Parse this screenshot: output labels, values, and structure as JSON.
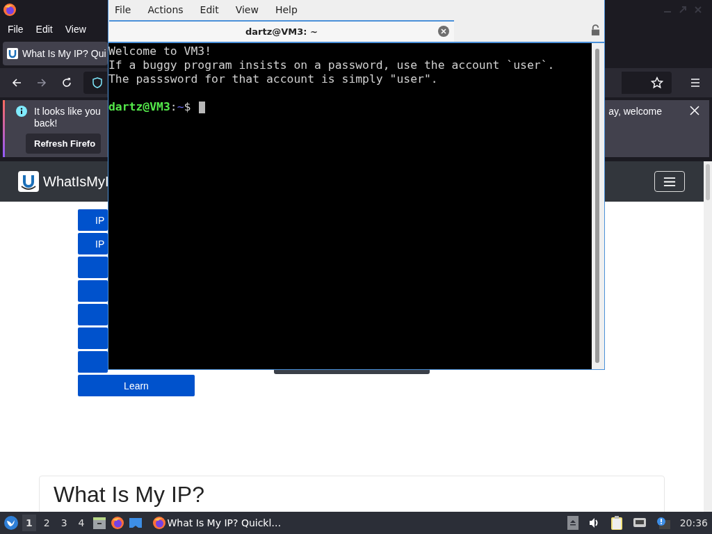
{
  "browser": {
    "menu": [
      "File",
      "Edit",
      "View"
    ],
    "tab": {
      "title": "What Is My IP? Qui"
    },
    "notification": {
      "text_start": "It looks like you",
      "text_end": "ay, welcome",
      "text_second_line": "back!",
      "button": "Refresh Firefo"
    },
    "site": {
      "brand": "WhatIsMyI",
      "nav_buttons": [
        {
          "kind": "labeled",
          "label": "IP"
        },
        {
          "kind": "labeled",
          "label": "IP"
        },
        {
          "kind": "covered"
        },
        {
          "kind": "covered"
        },
        {
          "kind": "covered"
        },
        {
          "kind": "covered"
        },
        {
          "kind": "covered"
        },
        {
          "kind": "labeled",
          "label": "Learn"
        }
      ],
      "card_heading": "What Is My IP?"
    }
  },
  "terminal": {
    "menu": [
      "File",
      "Actions",
      "Edit",
      "View",
      "Help"
    ],
    "tab": {
      "title": "dartz@VM3: ~"
    },
    "lines": [
      {
        "kind": "output",
        "text": "Welcome to VM3!"
      },
      {
        "kind": "output",
        "text": "If a buggy program insists on a password, use the account `user`."
      },
      {
        "kind": "output",
        "text": "The passsword for that account is simply \"user\"."
      },
      {
        "kind": "blank"
      },
      {
        "kind": "prompt",
        "user_host": "dartz@VM3",
        "separator": ":",
        "path": "~",
        "symbol": "$"
      }
    ]
  },
  "taskbar": {
    "workspaces": [
      {
        "label": "1",
        "selected": true
      },
      {
        "label": "2",
        "selected": false
      },
      {
        "label": "3",
        "selected": false
      },
      {
        "label": "4",
        "selected": false
      }
    ],
    "task": {
      "title": "What Is My IP? Quickl…"
    },
    "clock": "20:36"
  }
}
